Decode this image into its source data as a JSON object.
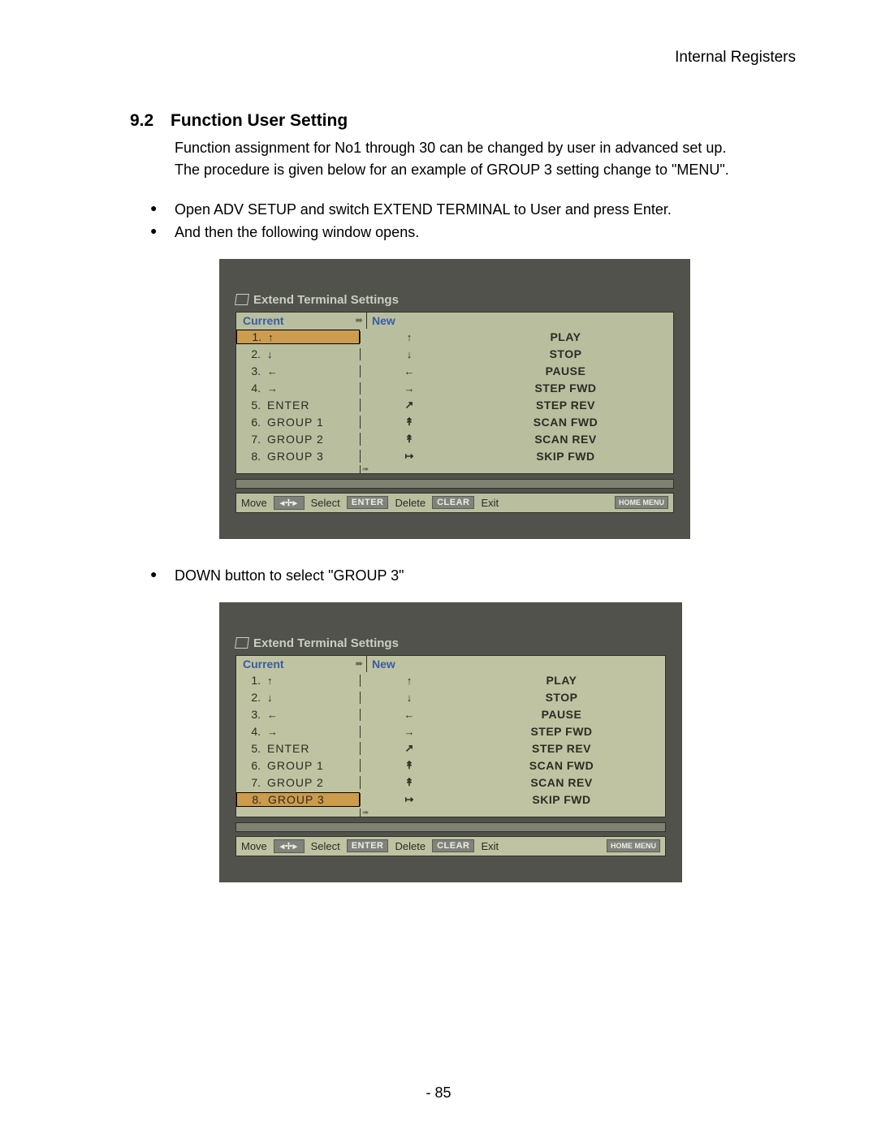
{
  "header": {
    "right": "Internal Registers"
  },
  "section": {
    "number": "9.2",
    "title": "Function User Setting"
  },
  "intro": {
    "l1": "Function assignment for No1 through 30 can be changed by user in advanced set up.",
    "l2": "The procedure is given below for an example of GROUP 3 setting change to \"MENU\"."
  },
  "bullets1": [
    "Open ADV SETUP and switch EXTEND TERMINAL to User and press Enter.",
    "And then the following window opens."
  ],
  "bullets2": [
    "DOWN button to select \"GROUP 3\""
  ],
  "panel": {
    "title": "Extend Terminal Settings",
    "col_current": "Current",
    "col_new": "New",
    "rows": [
      {
        "n": "1.",
        "left_icon": "↑",
        "left_text": "",
        "mid_icon": "↑",
        "right": "PLAY"
      },
      {
        "n": "2.",
        "left_icon": "↓",
        "left_text": "",
        "mid_icon": "↓",
        "right": "STOP"
      },
      {
        "n": "3.",
        "left_icon": "←",
        "left_text": "",
        "mid_icon": "←",
        "right": "PAUSE"
      },
      {
        "n": "4.",
        "left_icon": "→",
        "left_text": "",
        "mid_icon": "→",
        "right": "STEP FWD"
      },
      {
        "n": "5.",
        "left_icon": "",
        "left_text": "ENTER",
        "mid_icon": "↗",
        "right": "STEP REV"
      },
      {
        "n": "6.",
        "left_icon": "",
        "left_text": "GROUP   1",
        "mid_icon": "↟",
        "right": "SCAN FWD"
      },
      {
        "n": "7.",
        "left_icon": "",
        "left_text": "GROUP   2",
        "mid_icon": "↟",
        "right": "SCAN REV"
      },
      {
        "n": "8.",
        "left_icon": "",
        "left_text": "GROUP   3",
        "mid_icon": "↦",
        "right": "SKIP FWD"
      }
    ],
    "btnbar": {
      "move": "Move",
      "nav": "◂✢▸",
      "select": "Select",
      "enter": "ENTER",
      "delete": "Delete",
      "clear": "CLEAR",
      "exit": "Exit",
      "home": "HOME MENU"
    }
  },
  "sel1": 0,
  "sel2": 7,
  "page_number": "- 85"
}
